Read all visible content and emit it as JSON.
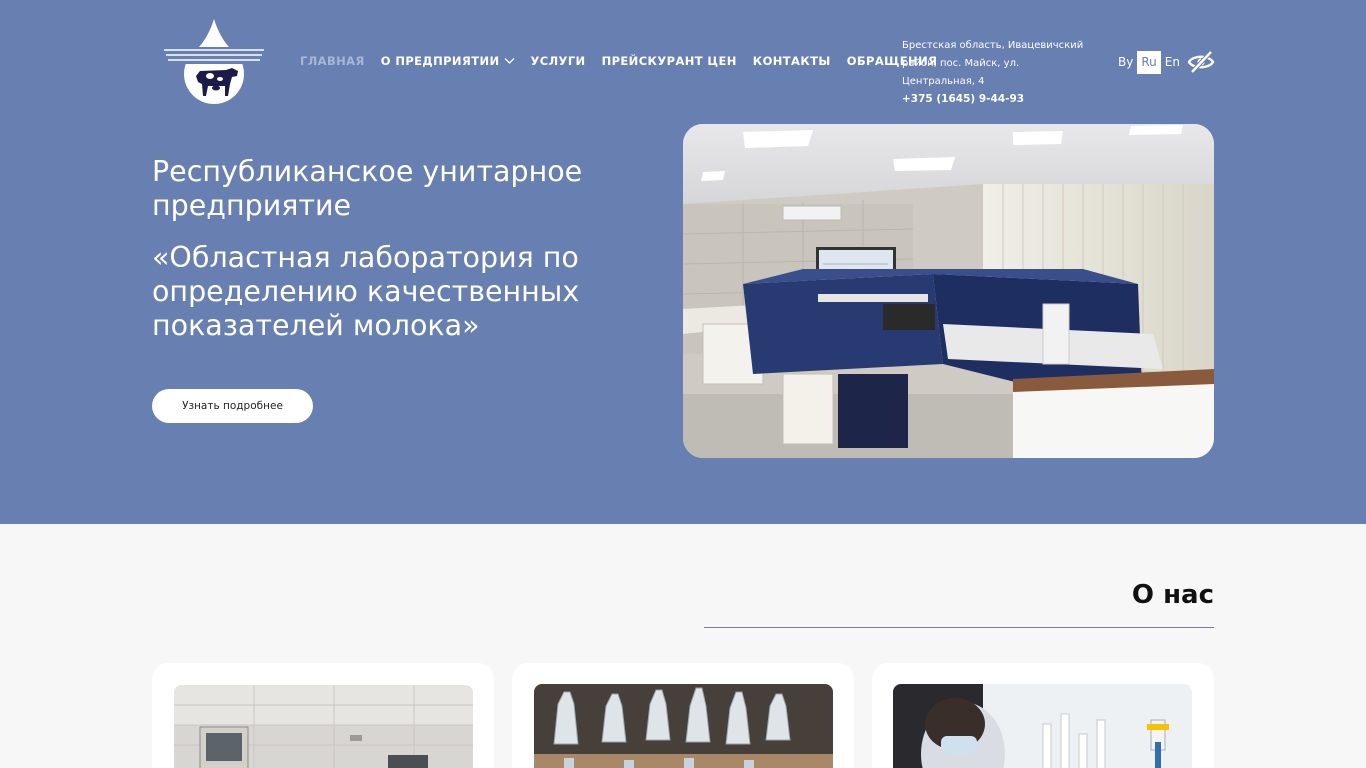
{
  "header": {
    "logo_text": "РЕСПУБЛИКАНСКОЕ УНИТАРНОЕ ПРЕДПРИЯТИЕ «ОБЛАСТНАЯ ЛАБОРАТОРИЯ ПО ОПРЕДЕЛЕНИЮ КАЧЕСТВЕННЫХ ПОКАЗАТЕЛЕЙ МОЛОКА»",
    "nav": [
      {
        "label": "ГЛАВНАЯ"
      },
      {
        "label": "О ПРЕДПРИЯТИИ"
      },
      {
        "label": "УСЛУГИ"
      },
      {
        "label": "ПРЕЙСКУРАНТ ЦЕН"
      },
      {
        "label": "КОНТАКТЫ"
      },
      {
        "label": "ОБРАЩЕНИЯ"
      }
    ],
    "address": "Брестская область, Ивацевичский район, пос. Майск, ул. Центральная, 4",
    "phone": "+375 (1645) 9-44-93",
    "langs": [
      "By",
      "Ru",
      "En"
    ],
    "active_lang": "Ru",
    "accessibility_icon": "eye-off-icon"
  },
  "hero": {
    "title": "Республиканское унитарное предприятие",
    "subtitle": "«Областная лаборатория по определению качественных показателей молока»",
    "button": "Узнать подробнее",
    "image": "laboratory-photo"
  },
  "about": {
    "title": "О нас",
    "cards": [
      {
        "image": "lab-equipment-photo"
      },
      {
        "image": "milk-sample-bottles-photo"
      },
      {
        "image": "lab-technician-photo"
      }
    ]
  },
  "colors": {
    "brand": "#677fb1",
    "background": "#f7f7f7",
    "logo_dark": "#1b1a4a"
  }
}
